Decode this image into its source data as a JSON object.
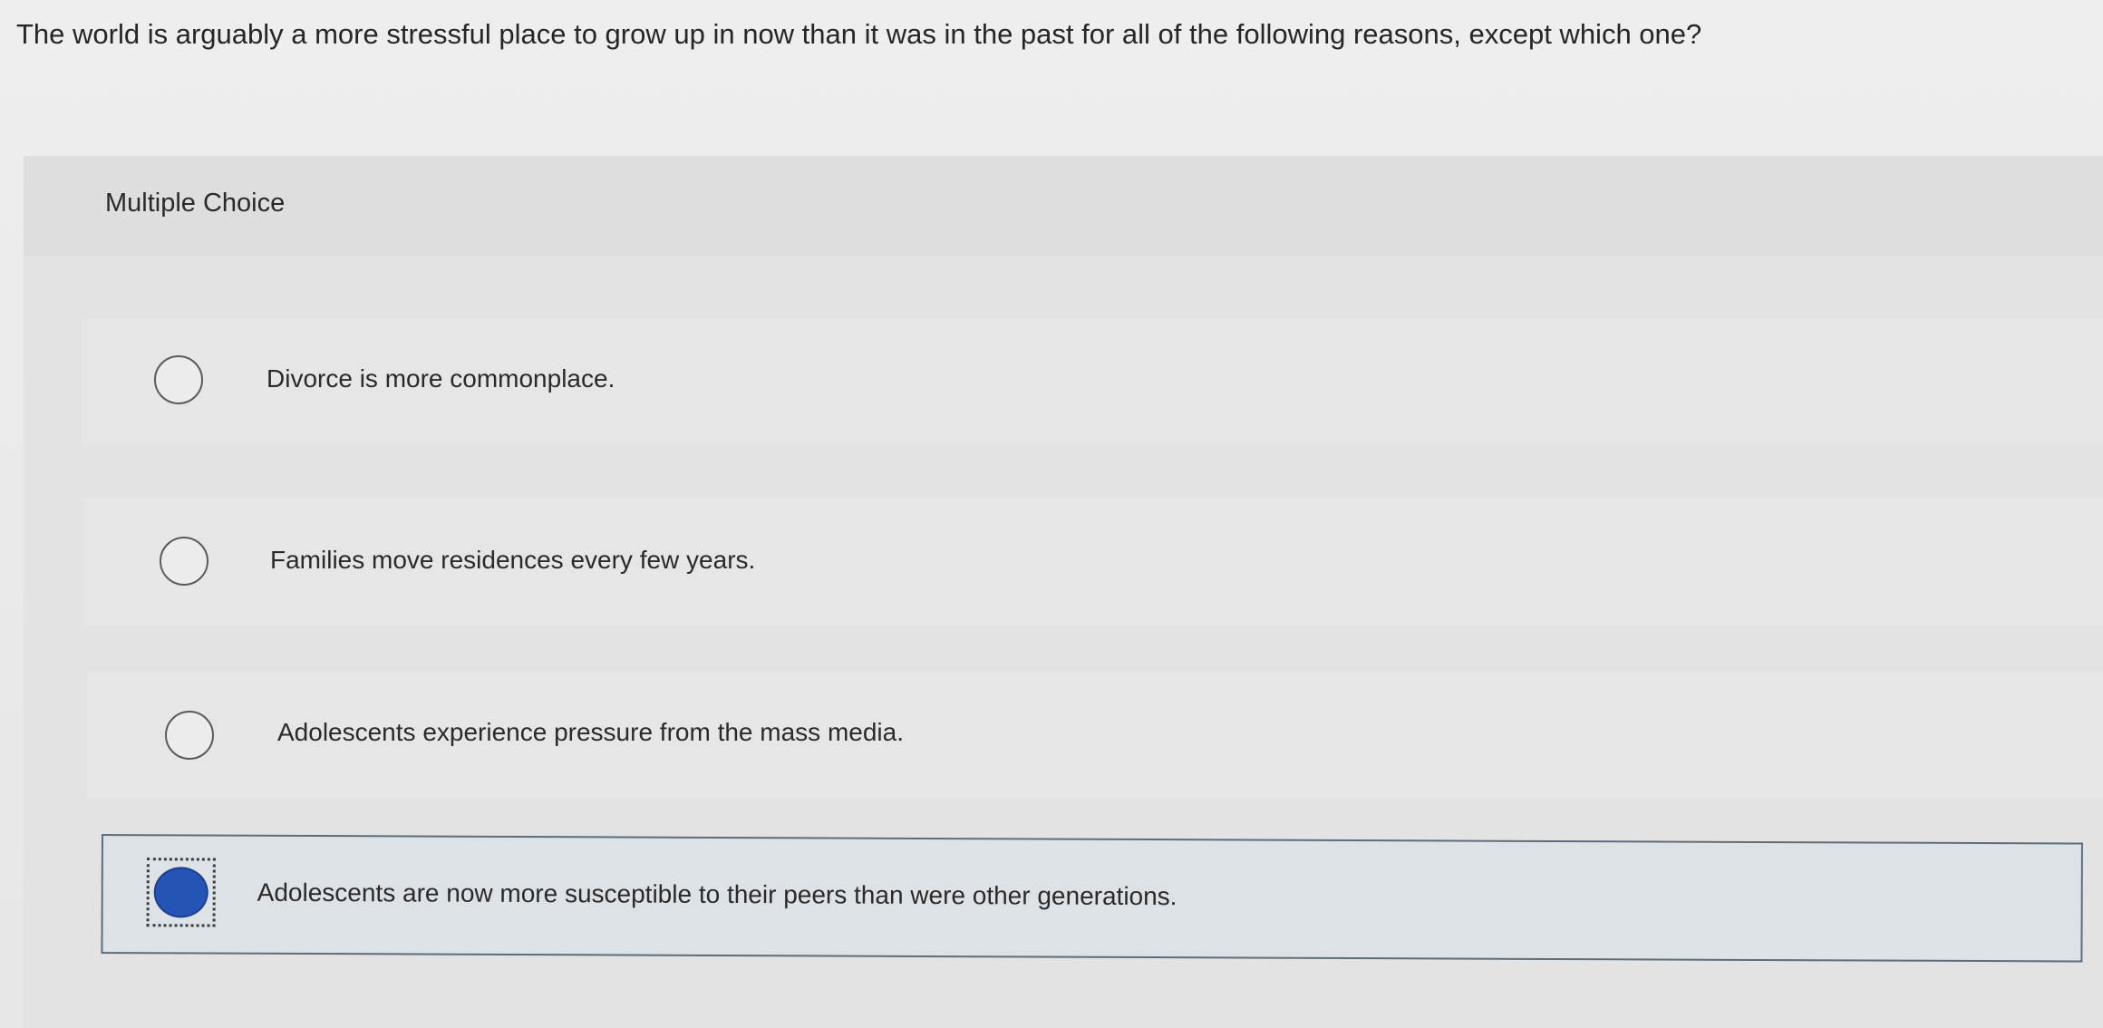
{
  "question": {
    "text": "The world is arguably a more stressful place to grow up in now than it was in the past for all of the following reasons, except which one?"
  },
  "panel": {
    "type_label": "Multiple Choice"
  },
  "options": [
    {
      "text": "Divorce is more commonplace.",
      "selected": false
    },
    {
      "text": "Families move residences every few years.",
      "selected": false
    },
    {
      "text": "Adolescents experience pressure from the mass media.",
      "selected": false
    },
    {
      "text": "Adolescents are now more susceptible to their peers than were other generations.",
      "selected": true
    }
  ],
  "colors": {
    "selected_radio": "#2553b6",
    "selected_background": "#dde2e7",
    "selected_border": "#5e6d7a"
  }
}
